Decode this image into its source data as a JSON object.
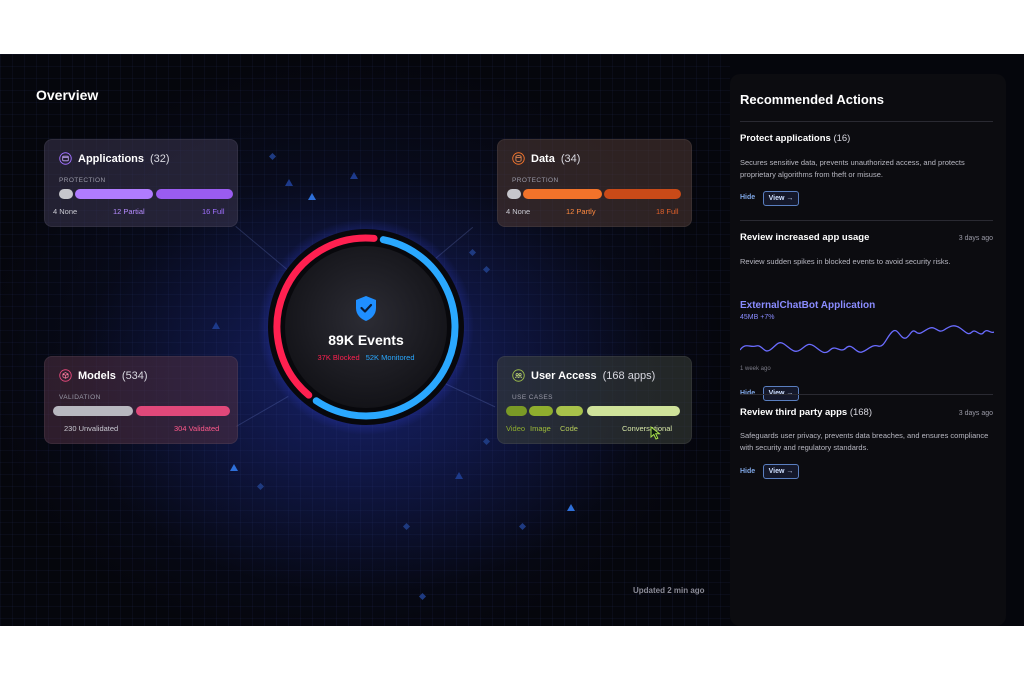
{
  "overview": {
    "title": "Overview"
  },
  "applications": {
    "title": "Applications",
    "count": "(32)",
    "subtitle": "PROTECTION",
    "legend": [
      "4 None",
      "12 Partial",
      "16 Full"
    ],
    "colors": [
      "#c6c6cc",
      "#b07cff",
      "#9a5cf0"
    ]
  },
  "data_card": {
    "title": "Data",
    "count": "(34)",
    "subtitle": "PROTECTION",
    "legend": [
      "4 None",
      "12 Partly",
      "18 Full"
    ],
    "colors": [
      "#c6c6cc",
      "#f2732a",
      "#c94a18"
    ]
  },
  "models": {
    "title": "Models",
    "count": "(534)",
    "subtitle": "VALIDATION",
    "legend": [
      "230 Unvalidated",
      "304 Validated"
    ],
    "colors": [
      "#b8b8c0",
      "#e0487a"
    ]
  },
  "user_access": {
    "title": "User Access",
    "count": "(168 apps)",
    "subtitle": "USE CASES",
    "legend": [
      "Video",
      "Image",
      "Code",
      "Conversational"
    ],
    "colors": [
      "#7a9a26",
      "#8fae2e",
      "#a8c24a",
      "#cfe29a"
    ]
  },
  "events": {
    "title": "89K Events",
    "blocked": "37K Blocked",
    "monitored": "52K Monitored",
    "blocked_color": "#ff2050",
    "monitored_color": "#2aa8ff",
    "blocked_fraction": 0.42
  },
  "updated": "Updated 2 min ago",
  "panel": {
    "title": "Recommended Actions",
    "items": [
      {
        "title": "Protect applications",
        "count": "(16)",
        "date": "",
        "desc": "Secures sensitive data, prevents unauthorized access, and protects proprietary algorithms from theft or misuse.",
        "hide": "Hide",
        "view": "View →"
      },
      {
        "title": "Review increased app usage",
        "count": "",
        "date": "3 days ago",
        "desc": "Review sudden spikes in blocked events to avoid security risks.",
        "app_name": "ExternalChatBot Application",
        "app_meta": "45MB +7%",
        "spark_label": "1 week ago",
        "hide": "Hide",
        "view": "View →"
      },
      {
        "title": "Review third party apps",
        "count": "(168)",
        "date": "3 days ago",
        "desc": "Safeguards user privacy, prevents data breaches, and ensures compliance with security and regulatory standards.",
        "hide": "Hide",
        "view": "View →"
      }
    ]
  },
  "icons": {
    "applications": "window-icon",
    "data": "database-icon",
    "models": "cube-icon",
    "user_access": "users-icon",
    "events": "shield-check-icon",
    "cursor": "cursor-icon"
  }
}
